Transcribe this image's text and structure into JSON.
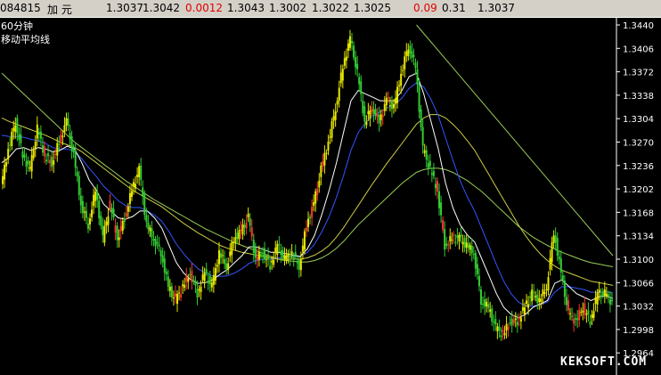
{
  "quote_bar": {
    "code": "084815",
    "name": "加  元",
    "v1": "1.3037",
    "v2": "1.3042",
    "change": "0.0012",
    "v3": "1.3043",
    "v4": "1.3002",
    "v5": "1.3022",
    "v6": "1.3025",
    "pct": "0.09",
    "v7": "0.31",
    "v8": "1.3037"
  },
  "chart_labels": {
    "period": "60分钟",
    "indicator": "移动平均线"
  },
  "watermark": "KEKSOFT.COM",
  "colors": {
    "background": "#000000",
    "axis": "#ffffff",
    "candle_up": "#e8e800",
    "candle_down": "#33cc33",
    "candle_red": "#ff3333",
    "ma_white": "#ffffff",
    "ma_blue": "#3355ff",
    "ma_yellow": "#cccc44",
    "ma_green": "#99cc55",
    "trendline": "#99cc55"
  },
  "chart_data": {
    "type": "line",
    "y_ticks": [
      "1.3440",
      "1.3406",
      "1.3372",
      "1.3338",
      "1.3304",
      "1.3270",
      "1.3236",
      "1.3202",
      "1.3168",
      "1.3134",
      "1.3100",
      "1.3066",
      "1.3032",
      "1.2998",
      "1.2964"
    ],
    "ylim": [
      1.2958,
      1.3448
    ],
    "price": [
      1.3205,
      1.326,
      1.33,
      1.325,
      1.323,
      1.329,
      1.325,
      1.324,
      1.327,
      1.33,
      1.325,
      1.318,
      1.315,
      1.32,
      1.313,
      1.318,
      1.313,
      1.316,
      1.32,
      1.323,
      1.315,
      1.313,
      1.311,
      1.306,
      1.304,
      1.306,
      1.308,
      1.305,
      1.308,
      1.306,
      1.311,
      1.309,
      1.313,
      1.314,
      1.316,
      1.31,
      1.311,
      1.309,
      1.312,
      1.31,
      1.311,
      1.309,
      1.315,
      1.318,
      1.323,
      1.327,
      1.332,
      1.338,
      1.342,
      1.337,
      1.33,
      1.332,
      1.33,
      1.333,
      1.332,
      1.337,
      1.341,
      1.338,
      1.326,
      1.323,
      1.32,
      1.312,
      1.313,
      1.313,
      1.312,
      1.311,
      1.304,
      1.303,
      1.3,
      1.299,
      1.301,
      1.301,
      1.303,
      1.305,
      1.304,
      1.306,
      1.314,
      1.308,
      1.302,
      1.301,
      1.303,
      1.301,
      1.305,
      1.305,
      1.3037
    ],
    "ma_white": [
      1.324,
      1.3248,
      1.326,
      1.3262,
      1.3258,
      1.3262,
      1.326,
      1.3256,
      1.3258,
      1.3264,
      1.326,
      1.324,
      1.3215,
      1.32,
      1.318,
      1.317,
      1.316,
      1.3158,
      1.3162,
      1.317,
      1.317,
      1.316,
      1.3145,
      1.312,
      1.3095,
      1.308,
      1.307,
      1.3065,
      1.3066,
      1.307,
      1.3078,
      1.3085,
      1.3095,
      1.3105,
      1.3118,
      1.3118,
      1.3114,
      1.311,
      1.311,
      1.3108,
      1.3106,
      1.3104,
      1.3115,
      1.3135,
      1.3165,
      1.32,
      1.324,
      1.3285,
      1.333,
      1.3345,
      1.334,
      1.3335,
      1.333,
      1.333,
      1.333,
      1.3345,
      1.3365,
      1.337,
      1.334,
      1.33,
      1.326,
      1.321,
      1.3175,
      1.315,
      1.3135,
      1.3125,
      1.31,
      1.3075,
      1.305,
      1.303,
      1.302,
      1.3015,
      1.302,
      1.303,
      1.3035,
      1.304,
      1.3065,
      1.307,
      1.306,
      1.305,
      1.3045,
      1.304,
      1.3045,
      1.3047,
      1.3043
    ],
    "ma_blue": [
      1.328,
      1.3278,
      1.3278,
      1.3277,
      1.3274,
      1.3272,
      1.3268,
      1.3262,
      1.326,
      1.326,
      1.3256,
      1.3246,
      1.3232,
      1.322,
      1.3206,
      1.3196,
      1.3185,
      1.3178,
      1.3175,
      1.3175,
      1.317,
      1.3164,
      1.3155,
      1.314,
      1.3122,
      1.3108,
      1.3096,
      1.3086,
      1.308,
      1.3076,
      1.3075,
      1.3076,
      1.308,
      1.3086,
      1.3094,
      1.3098,
      1.31,
      1.31,
      1.3102,
      1.3103,
      1.3104,
      1.3104,
      1.311,
      1.3122,
      1.314,
      1.3162,
      1.319,
      1.3222,
      1.3258,
      1.3284,
      1.3298,
      1.3308,
      1.3314,
      1.332,
      1.3324,
      1.3334,
      1.3348,
      1.3356,
      1.335,
      1.3332,
      1.3308,
      1.3276,
      1.3244,
      1.3214,
      1.319,
      1.317,
      1.3144,
      1.3118,
      1.3092,
      1.3068,
      1.305,
      1.3038,
      1.3032,
      1.3032,
      1.3034,
      1.3038,
      1.3052,
      1.306,
      1.306,
      1.3058,
      1.3056,
      1.3052,
      1.3052,
      1.3053,
      1.3051
    ],
    "ma_yellow": [
      1.3305,
      1.33,
      1.3296,
      1.3292,
      1.3288,
      1.3284,
      1.328,
      1.3275,
      1.327,
      1.3266,
      1.3262,
      1.3256,
      1.3248,
      1.324,
      1.3232,
      1.3224,
      1.3216,
      1.3208,
      1.32,
      1.3194,
      1.3188,
      1.3182,
      1.3176,
      1.3168,
      1.316,
      1.3152,
      1.3145,
      1.3138,
      1.3132,
      1.3126,
      1.312,
      1.3116,
      1.3113,
      1.311,
      1.3108,
      1.3106,
      1.3104,
      1.3102,
      1.31,
      1.31,
      1.31,
      1.31,
      1.3102,
      1.3106,
      1.3112,
      1.312,
      1.3132,
      1.3146,
      1.3162,
      1.3178,
      1.3194,
      1.321,
      1.3225,
      1.324,
      1.3254,
      1.3268,
      1.3282,
      1.3296,
      1.3305,
      1.331,
      1.331,
      1.3305,
      1.3296,
      1.3285,
      1.3272,
      1.3258,
      1.324,
      1.3222,
      1.3204,
      1.3186,
      1.3168,
      1.315,
      1.3134,
      1.312,
      1.3108,
      1.3098,
      1.309,
      1.3084,
      1.308,
      1.3076,
      1.3072,
      1.3068,
      1.3066,
      1.3064,
      1.3062
    ],
    "ma_green": [
      1.337,
      1.336,
      1.335,
      1.334,
      1.333,
      1.332,
      1.331,
      1.33,
      1.329,
      1.328,
      1.327,
      1.3262,
      1.3254,
      1.3246,
      1.3238,
      1.323,
      1.3222,
      1.3214,
      1.3207,
      1.32,
      1.3193,
      1.3186,
      1.318,
      1.3174,
      1.3168,
      1.3162,
      1.3156,
      1.315,
      1.3144,
      1.3139,
      1.3134,
      1.3129,
      1.3124,
      1.312,
      1.3116,
      1.3112,
      1.3108,
      1.3104,
      1.31,
      1.3098,
      1.3097,
      1.3096,
      1.3096,
      1.3098,
      1.3102,
      1.3108,
      1.3116,
      1.3126,
      1.3138,
      1.315,
      1.316,
      1.317,
      1.318,
      1.319,
      1.32,
      1.321,
      1.3218,
      1.3226,
      1.323,
      1.3232,
      1.3232,
      1.323,
      1.3226,
      1.322,
      1.3214,
      1.3206,
      1.3198,
      1.3188,
      1.3178,
      1.3168,
      1.3158,
      1.3148,
      1.314,
      1.3132,
      1.3126,
      1.312,
      1.3115,
      1.311,
      1.3106,
      1.3102,
      1.3098,
      1.3095,
      1.3093,
      1.3091,
      1.3089
    ],
    "trendline": {
      "start_index": 57,
      "start_value": 1.344,
      "end_index": 84,
      "end_value": 1.3105
    },
    "legend": "none",
    "grid": false
  }
}
